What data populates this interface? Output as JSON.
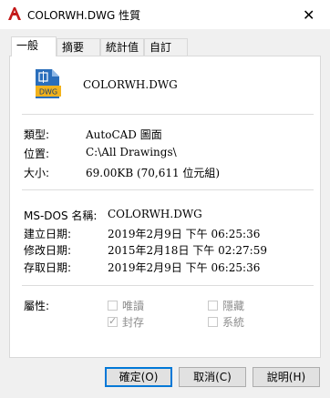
{
  "window": {
    "title": "COLORWH.DWG 性質",
    "app_icon": "autocad-icon",
    "close_icon": "close-icon",
    "close_glyph": "✕"
  },
  "tabs": [
    {
      "label": "一般",
      "active": true
    },
    {
      "label": "摘要",
      "active": false
    },
    {
      "label": "統計值",
      "active": false
    },
    {
      "label": "自訂",
      "active": false
    }
  ],
  "file": {
    "icon": "dwg-file-icon",
    "icon_text": "DWG",
    "name": "COLORWH.DWG"
  },
  "info": {
    "type_label": "類型:",
    "type_value": "AutoCAD 圖面",
    "location_label": "位置:",
    "location_value": "C:\\All Drawings\\",
    "size_label": "大小:",
    "size_value": "69.00KB (70,611 位元組)"
  },
  "dates": {
    "msdos_label": "MS-DOS 名稱:",
    "msdos_value": "COLORWH.DWG",
    "created_label": "建立日期:",
    "created_value": "2019年2月9日  下午 06:25:36",
    "modified_label": "修改日期:",
    "modified_value": "2015年2月18日  下午 02:27:59",
    "accessed_label": "存取日期:",
    "accessed_value": "2019年2月9日  下午 06:25:36"
  },
  "attributes": {
    "label": "屬性:",
    "readonly_label": "唯讀",
    "readonly_checked": false,
    "hidden_label": "隱藏",
    "hidden_checked": false,
    "archive_label": "封存",
    "archive_checked": true,
    "system_label": "系統",
    "system_checked": false,
    "check_glyph": "✓"
  },
  "buttons": {
    "ok": "確定(O)",
    "cancel": "取消(C)",
    "help": "說明(H)"
  },
  "colors": {
    "accent": "#0078d7",
    "autocad_red": "#c41a1a",
    "dwg_blue": "#2a6ebb",
    "dwg_yellow": "#f2b21c"
  }
}
